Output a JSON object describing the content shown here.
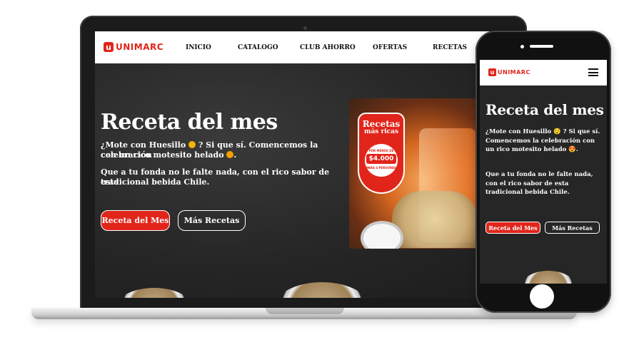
{
  "brand": {
    "mark": "u",
    "name": "UNIMARC",
    "accent": "#e1251b"
  },
  "nav": {
    "items": [
      "INICIO",
      "CATALOGO",
      "CLUB AHORRO",
      "OFERTAS",
      "RECETAS"
    ]
  },
  "hero": {
    "title": "Receta del mes",
    "line1_a": "¿Mote con Huesillo",
    "line1_b": "? Si que sí. Comencemos la celebración",
    "line2": "con un rico motesito helado",
    "line3": "Que a tu fonda no le falte nada, con el rico sabor de esta",
    "line4": "tradicional bebida Chile.",
    "btn_primary": "Receta del Mes",
    "btn_secondary": "Más Recetas"
  },
  "promo": {
    "title": "Recetas",
    "subtitle": "más ricas",
    "caption_top": "POR MENOS DE",
    "price": "$4.000",
    "caption_bottom": "PARA 4 PERSONAS"
  },
  "mobile": {
    "title": "Receta del mes",
    "p1": "¿Mote con Huesillo 😯 ? Si que sí. Comencemos la celebración con un rico motesito helado 😍.",
    "p2": "Que a tu fonda no le falte nada, con el rico sabor de esta tradicional bebida Chile.",
    "btn_primary": "Receta del Mes",
    "btn_secondary": "Más Recetas"
  }
}
